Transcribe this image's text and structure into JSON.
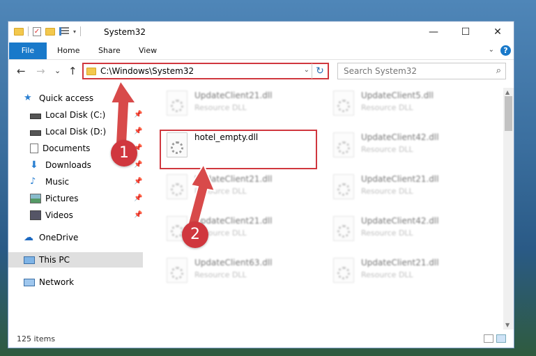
{
  "window": {
    "title": "System32",
    "controls": {
      "minimize": "—",
      "maximize": "☐",
      "close": "✕"
    }
  },
  "ribbon": {
    "file_tab": "File",
    "tabs": [
      "Home",
      "Share",
      "View"
    ],
    "help_icon": "?",
    "accent": "#1979ca"
  },
  "navigation": {
    "back": "←",
    "forward": "→",
    "recent": "⌄",
    "up": "↑",
    "address": "C:\\Windows\\System32",
    "search_placeholder": "Search System32"
  },
  "sidebar": {
    "items": [
      {
        "label": "Quick access",
        "icon": "star-icon",
        "pinned": false
      },
      {
        "label": "Local Disk (C:)",
        "icon": "disk-icon",
        "pinned": true
      },
      {
        "label": "Local Disk (D:)",
        "icon": "disk-icon",
        "pinned": true
      },
      {
        "label": "Documents",
        "icon": "documents-icon",
        "pinned": true
      },
      {
        "label": "Downloads",
        "icon": "download-icon",
        "pinned": true
      },
      {
        "label": "Music",
        "icon": "music-icon",
        "pinned": true
      },
      {
        "label": "Pictures",
        "icon": "pictures-icon",
        "pinned": true
      },
      {
        "label": "Videos",
        "icon": "videos-icon",
        "pinned": true
      },
      {
        "label": "OneDrive",
        "icon": "cloud-icon",
        "pinned": false
      },
      {
        "label": "This PC",
        "icon": "computer-icon",
        "pinned": false,
        "selected": true
      },
      {
        "label": "Network",
        "icon": "network-icon",
        "pinned": false
      }
    ]
  },
  "files": {
    "left": [
      {
        "name": "UpdateClient21.dll",
        "type": "Resource DLL"
      },
      {
        "name": "hotel_empty.dll",
        "type": ""
      },
      {
        "name": "UpdateClient21.dll",
        "type": "Resource DLL"
      },
      {
        "name": "UpdateClient21.dll",
        "type": "Resource DLL"
      },
      {
        "name": "UpdateClient63.dll",
        "type": "Resource DLL"
      }
    ],
    "right": [
      {
        "name": "UpdateClient5.dll",
        "type": "Resource DLL"
      },
      {
        "name": "UpdateClient42.dll",
        "type": "Resource DLL"
      },
      {
        "name": "UpdateClient21.dll",
        "type": "Resource DLL"
      },
      {
        "name": "UpdateClient42.dll",
        "type": "Resource DLL"
      },
      {
        "name": "UpdateClient21.dll",
        "type": "Resource DLL"
      }
    ]
  },
  "status": {
    "item_count": "125 items"
  },
  "annotations": {
    "step1": "1",
    "step2": "2",
    "color": "#d0373e"
  }
}
